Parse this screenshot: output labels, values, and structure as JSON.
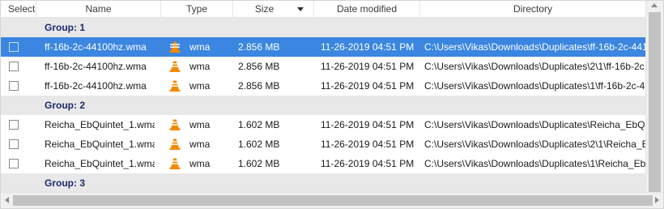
{
  "columns": {
    "select": "Select",
    "name": "Name",
    "type": "Type",
    "size": "Size",
    "date": "Date modified",
    "directory": "Directory"
  },
  "sort_column": "size",
  "groups": [
    {
      "label": "Group: 1",
      "files": [
        {
          "name": "ff-16b-2c-44100hz.wma",
          "icon": "vlc-icon",
          "type": "wma",
          "size": "2.856 MB",
          "date": "11-26-2019 04:51 PM",
          "directory": "C:\\Users\\Vikas\\Downloads\\Duplicates\\ff-16b-2c-441",
          "selected": true
        },
        {
          "name": "ff-16b-2c-44100hz.wma",
          "icon": "vlc-icon",
          "type": "wma",
          "size": "2.856 MB",
          "date": "11-26-2019 04:51 PM",
          "directory": "C:\\Users\\Vikas\\Downloads\\Duplicates\\2\\1\\ff-16b-2c",
          "selected": false
        },
        {
          "name": "ff-16b-2c-44100hz.wma",
          "icon": "vlc-icon",
          "type": "wma",
          "size": "2.856 MB",
          "date": "11-26-2019 04:51 PM",
          "directory": "C:\\Users\\Vikas\\Downloads\\Duplicates\\1\\ff-16b-2c-4",
          "selected": false
        }
      ]
    },
    {
      "label": "Group: 2",
      "files": [
        {
          "name": "Reicha_EbQuintet_1.wma",
          "icon": "vlc-icon",
          "type": "wma",
          "size": "1.602 MB",
          "date": "11-26-2019 04:51 PM",
          "directory": "C:\\Users\\Vikas\\Downloads\\Duplicates\\Reicha_EbQu",
          "selected": false
        },
        {
          "name": "Reicha_EbQuintet_1.wma",
          "icon": "vlc-icon",
          "type": "wma",
          "size": "1.602 MB",
          "date": "11-26-2019 04:51 PM",
          "directory": "C:\\Users\\Vikas\\Downloads\\Duplicates\\2\\1\\Reicha_El",
          "selected": false
        },
        {
          "name": "Reicha_EbQuintet_1.wma",
          "icon": "vlc-icon",
          "type": "wma",
          "size": "1.602 MB",
          "date": "11-26-2019 04:51 PM",
          "directory": "C:\\Users\\Vikas\\Downloads\\Duplicates\\1\\Reicha_EbQ",
          "selected": false
        }
      ]
    },
    {
      "label": "Group: 3",
      "files": []
    }
  ],
  "colors": {
    "selection": "#3a86e0",
    "group_text": "#1d2a6b",
    "group_bg": "#e8e8e8",
    "vlc_orange": "#f28a00"
  }
}
